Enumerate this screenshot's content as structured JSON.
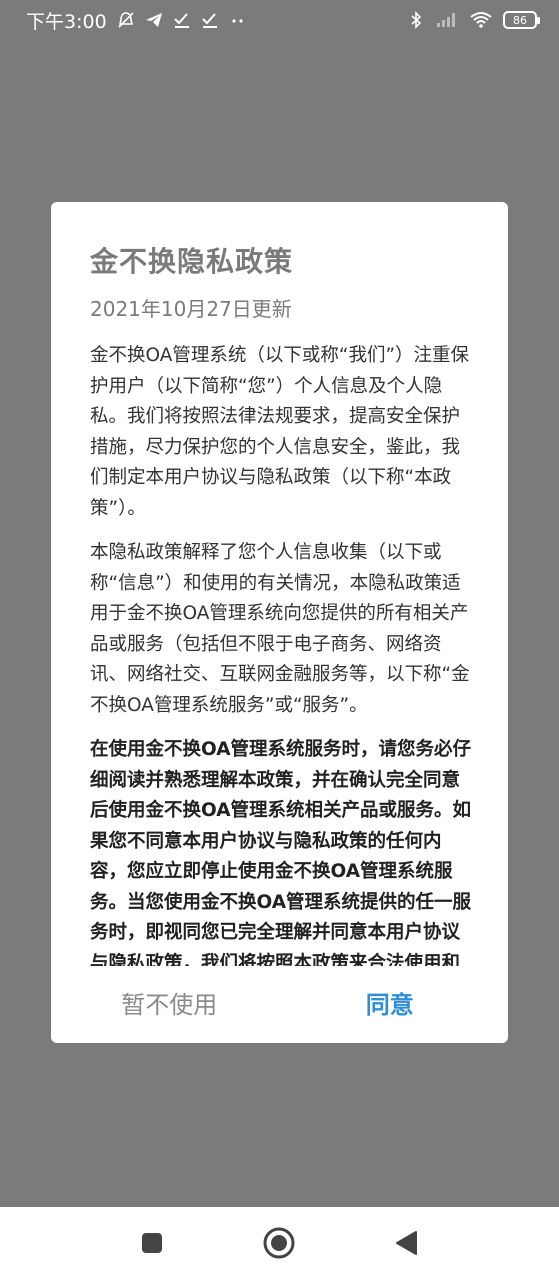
{
  "status_bar": {
    "time": "下午3:00",
    "battery": "86"
  },
  "dialog": {
    "title": "金不换隐私政策",
    "date": "2021年10月27日更新",
    "paragraphs": [
      "金不换OA管理系统（以下或称“我们”）注重保护用户（以下简称“您”）个人信息及个人隐私。我们将按照法律法规要求，提高安全保护措施，尽力保护您的个人信息安全，鉴此，我们制定本用户协议与隐私政策（以下称“本政策”）。",
      "本隐私政策解释了您个人信息收集（以下或称“信息”）和使用的有关情况，本隐私政策适用于金不换OA管理系统向您提供的所有相关产品或服务（包括但不限于电子商务、网络资讯、网络社交、互联网金融服务等，以下称“金不换OA管理系统服务”或“服务”。",
      "在使用金不换OA管理系统服务时，请您务必仔细阅读并熟悉理解本政策，并在确认完全同意后使用金不换OA管理系统相关产品或服务。如果您不同意本用户协议与隐私政策的任何内容，您应立即停止使用金不换OA管理系统服务。当您使用金不换OA管理系统提供的任一服务时，即视同您已完全理解并同意本用户协议与隐私政策，我们将按照本政策来合法使用和"
    ],
    "decline_label": "暂不使用",
    "agree_label": "同意"
  },
  "colors": {
    "scrim": "#7b7b7b",
    "accent": "#2e8fd8",
    "muted_text": "#7a7a7a"
  },
  "nav": {
    "icons": [
      "recents-square-icon",
      "home-circle-icon",
      "back-triangle-icon"
    ]
  }
}
